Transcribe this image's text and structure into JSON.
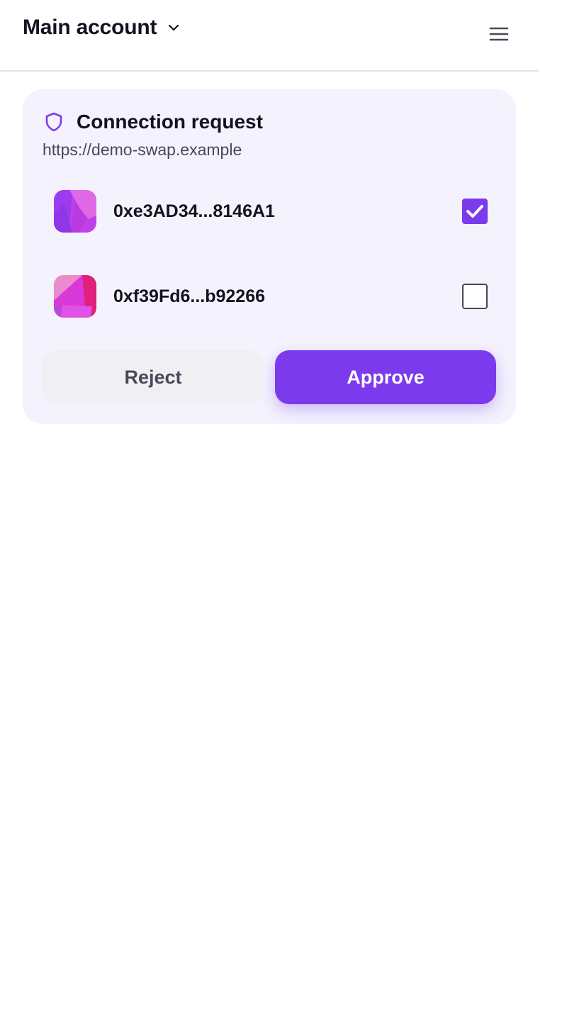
{
  "header": {
    "account_name": "Main account",
    "account_icon": "chevron-down-icon",
    "menu_icon": "hamburger-menu-icon"
  },
  "request": {
    "title": "Connection request",
    "icon": "shield-icon",
    "origin": "https://demo-swap.example",
    "accounts": [
      {
        "address": "0xe3AD34...8146A1",
        "checked": true
      },
      {
        "address": "0xf39Fd6...b92266",
        "checked": false
      }
    ],
    "reject_label": "Reject",
    "approve_label": "Approve"
  },
  "colors": {
    "accent": "#7c3aed",
    "card_background": "#f4f2fd",
    "text_primary": "#15121f",
    "text_secondary": "#4a4759",
    "reject_background": "#f0f0f4"
  }
}
